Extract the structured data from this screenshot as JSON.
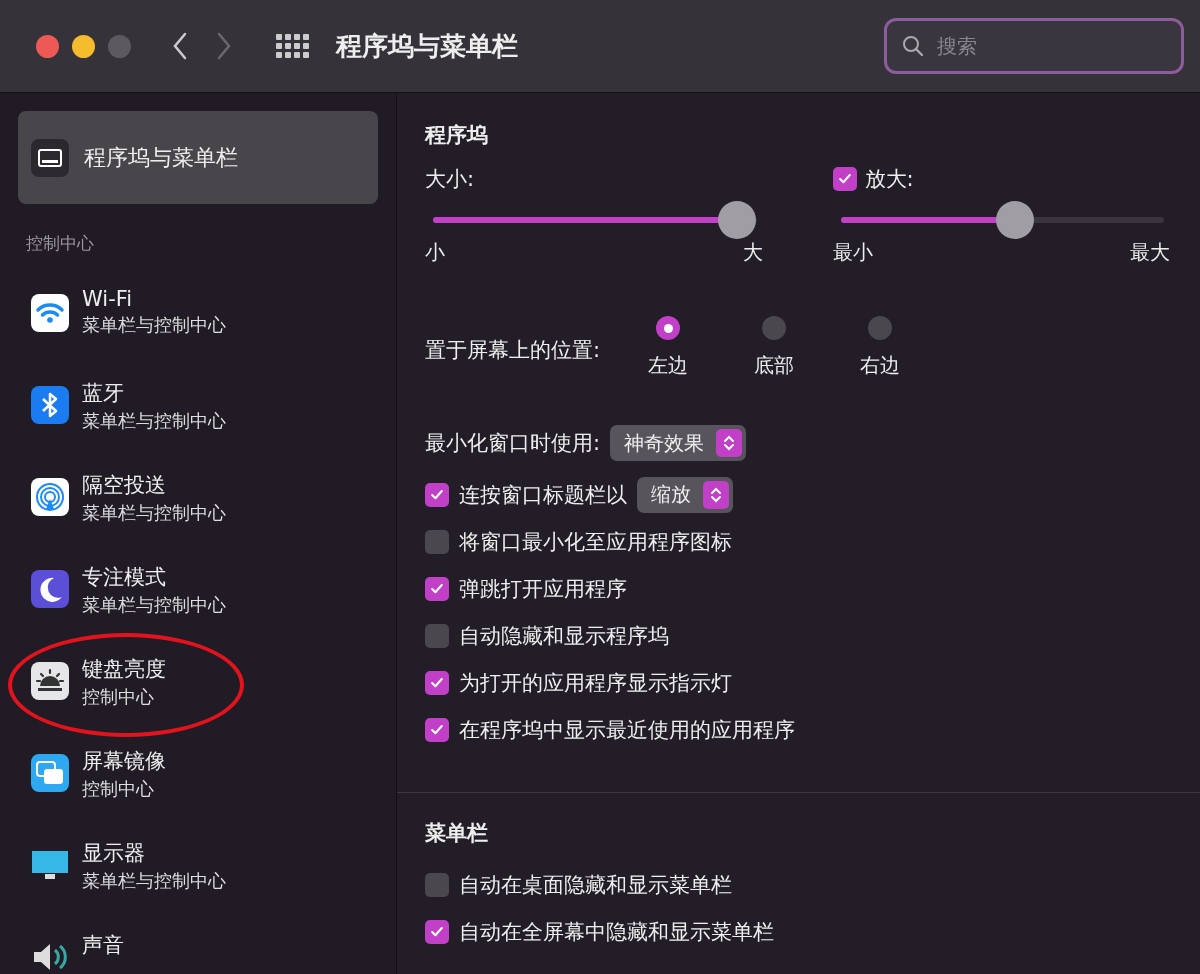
{
  "window": {
    "title": "程序坞与菜单栏"
  },
  "toolbar": {
    "search": {
      "placeholder": "搜索"
    }
  },
  "sidebar": {
    "items": [
      {
        "title": "程序坞与菜单栏",
        "kind": "dock",
        "selected": true
      }
    ],
    "section": {
      "title": "控制中心",
      "items": [
        {
          "title": "Wi-Fi",
          "subtitle": "菜单栏与控制中心",
          "kind": "wifi",
          "selected": false,
          "circled": false
        },
        {
          "title": "蓝牙",
          "subtitle": "菜单栏与控制中心",
          "kind": "bluetooth",
          "selected": false,
          "circled": false
        },
        {
          "title": "隔空投送",
          "subtitle": "菜单栏与控制中心",
          "kind": "airdrop",
          "selected": false,
          "circled": false
        },
        {
          "title": "专注模式",
          "subtitle": "菜单栏与控制中心",
          "kind": "focus",
          "selected": false,
          "circled": false
        },
        {
          "title": "键盘亮度",
          "subtitle": "控制中心",
          "kind": "keyboard",
          "selected": false,
          "circled": true
        },
        {
          "title": "屏幕镜像",
          "subtitle": "控制中心",
          "kind": "mirroring",
          "selected": false,
          "circled": false
        },
        {
          "title": "显示器",
          "subtitle": "菜单栏与控制中心",
          "kind": "display",
          "selected": false,
          "circled": false
        },
        {
          "title": "声音",
          "kind": "sound",
          "selected": false,
          "circled": false
        }
      ]
    }
  },
  "dock": {
    "title": "程序坞",
    "size": {
      "label": "大小:",
      "level": 0.94,
      "min_label": "小",
      "max_label": "大"
    },
    "magnification": {
      "label": "放大:",
      "checked": true,
      "level": 0.54,
      "min_label": "最小",
      "max_label": "最大"
    },
    "position": {
      "label": "置于屏幕上的位置:",
      "options": [
        {
          "label": "左边",
          "selected": true
        },
        {
          "label": "底部",
          "selected": false
        },
        {
          "label": "右边",
          "selected": false
        }
      ]
    },
    "minimize_effect": {
      "label": "最小化窗口时使用:",
      "value": "神奇效果"
    },
    "options": [
      {
        "kind": "dropdown",
        "label": "连按窗口标题栏以",
        "checked": true,
        "value": "缩放"
      },
      {
        "kind": "checkbox",
        "label": "将窗口最小化至应用程序图标",
        "checked": false
      },
      {
        "kind": "checkbox",
        "label": "弹跳打开应用程序",
        "checked": true
      },
      {
        "kind": "checkbox",
        "label": "自动隐藏和显示程序坞",
        "checked": false
      },
      {
        "kind": "checkbox",
        "label": "为打开的应用程序显示指示灯",
        "checked": true
      },
      {
        "kind": "checkbox",
        "label": "在程序坞中显示最近使用的应用程序",
        "checked": true
      }
    ]
  },
  "menubar": {
    "title": "菜单栏",
    "options": [
      {
        "kind": "checkbox",
        "label": "自动在桌面隐藏和显示菜单栏",
        "checked": false
      },
      {
        "kind": "checkbox",
        "label": "自动在全屏幕中隐藏和显示菜单栏",
        "checked": true
      }
    ]
  }
}
